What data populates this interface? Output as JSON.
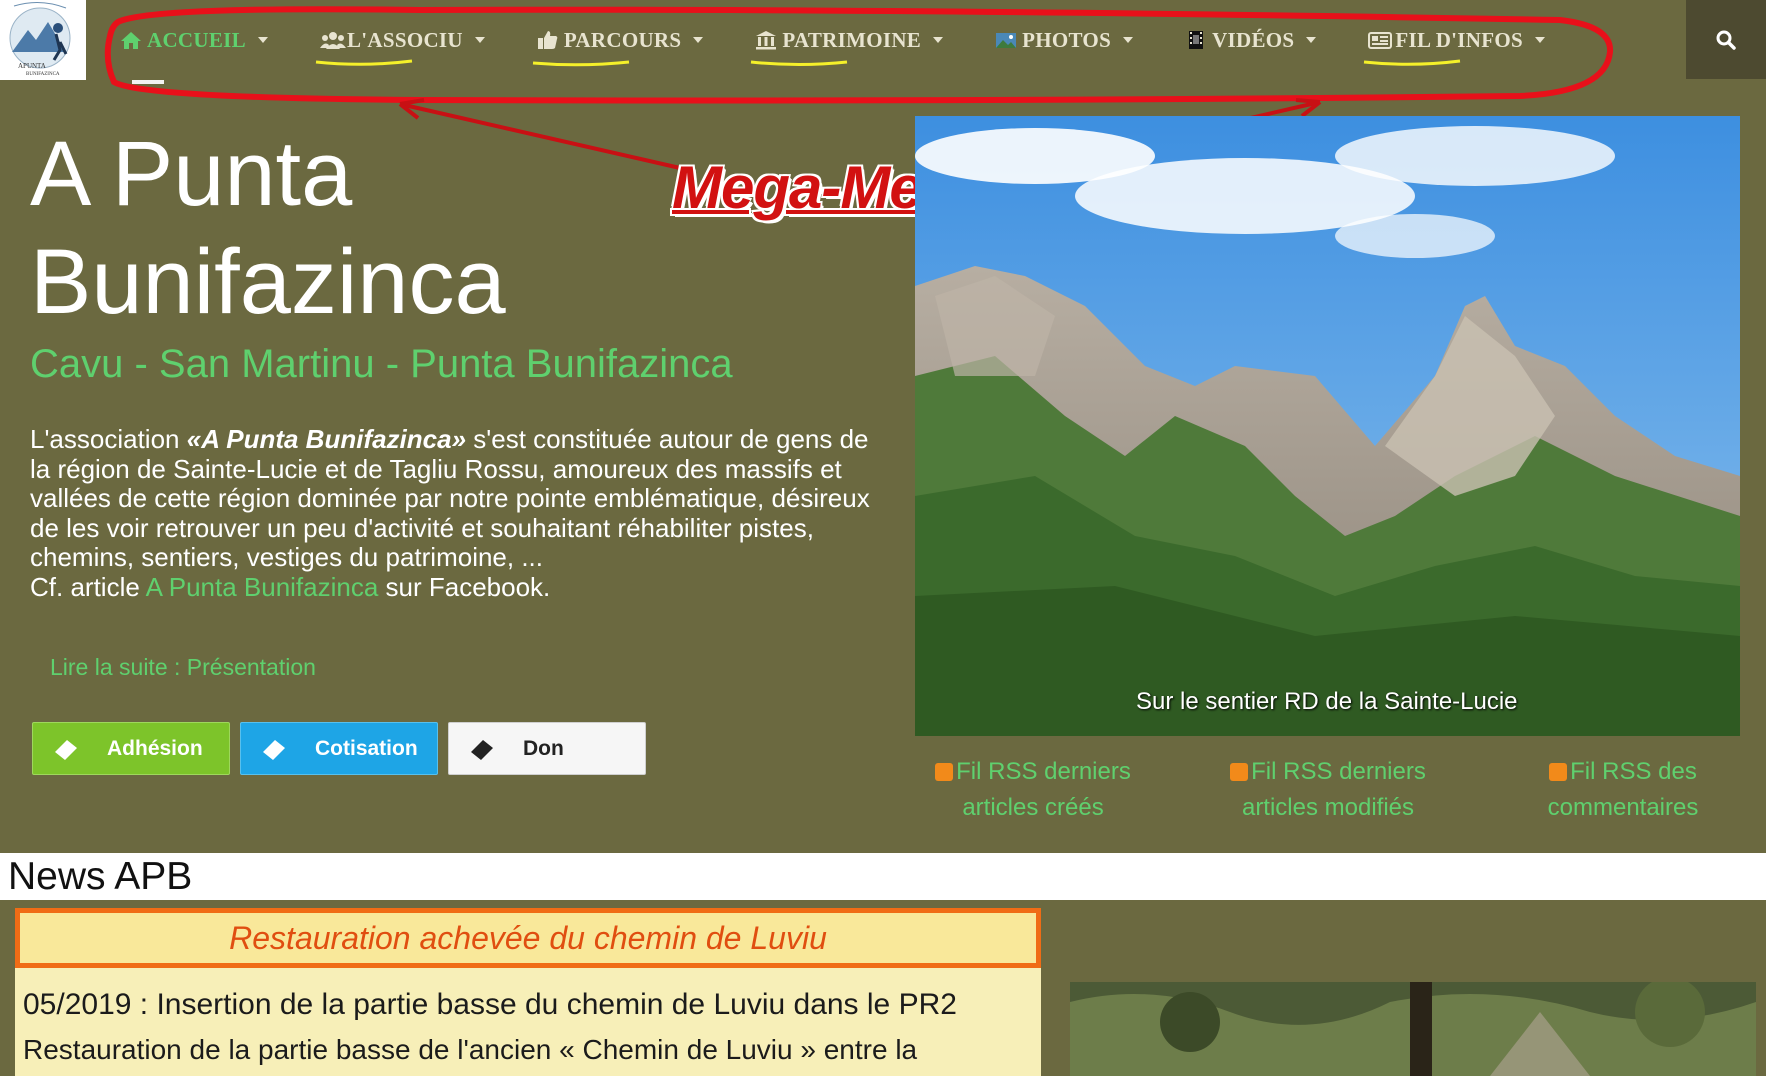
{
  "nav": {
    "items": [
      {
        "label": "ACCUEIL",
        "icon": "home-icon",
        "active": true
      },
      {
        "label": "L'ASSOCIU",
        "icon": "users-icon",
        "active": false
      },
      {
        "label": "PARCOURS",
        "icon": "thumbs-up-icon",
        "active": false
      },
      {
        "label": "PATRIMOINE",
        "icon": "institution-icon",
        "active": false
      },
      {
        "label": "PHOTOS",
        "icon": "image-icon",
        "active": false
      },
      {
        "label": "VIDÉOS",
        "icon": "film-icon",
        "active": false
      },
      {
        "label": "FIL D'INFOS",
        "icon": "newspaper-icon",
        "active": false
      }
    ],
    "search_icon": "search-icon"
  },
  "annotation": {
    "label": "Mega-Menu",
    "color": "#d21111",
    "underline_color": "#f5f02a"
  },
  "hero": {
    "title": "A Punta Bunifazinca",
    "subtitle": "Cavu - San Martinu - Punta Bunifazinca",
    "intro_prefix": "L'association ",
    "intro_em": "«A Punta Bunifazinca»",
    "intro_rest": " s'est constituée autour de gens de la région de Sainte-Lucie et de Tagliu Rossu, amoureux des massifs et vallées de cette région dominée par notre pointe emblématique, désireux de les voir retrouver un peu d'activité et souhaitant réhabiliter pistes, chemins, sentiers, vestiges du patrimoine, ...",
    "cf_prefix": "Cf. article ",
    "cf_link": "A Punta Bunifazinca",
    "cf_suffix": " sur Facebook.",
    "read_more": "Lire la suite : Présentation"
  },
  "buttons": [
    {
      "label": "Adhésion",
      "style": "green"
    },
    {
      "label": "Cotisation",
      "style": "blue"
    },
    {
      "label": "Don",
      "style": "white"
    }
  ],
  "image": {
    "caption": "Sur le sentier RD de la Sainte-Lucie"
  },
  "rss": [
    {
      "line1": "Fil RSS derniers",
      "line2": "articles créés"
    },
    {
      "line1": "Fil RSS derniers",
      "line2": "articles modifiés"
    },
    {
      "line1": "Fil RSS des",
      "line2": "commentaires"
    }
  ],
  "news": {
    "section_title": "News APB",
    "headline": "Restauration achevée du chemin de Luviu",
    "date_title": "05/2019 : Insertion de la partie basse du chemin de Luviu dans le PR2",
    "excerpt": "Restauration de la partie basse de l'ancien « Chemin de Luviu » entre la"
  },
  "colors": {
    "background": "#6b6940",
    "accent_green": "#5fd06e",
    "search_bg": "#4d4a30"
  }
}
